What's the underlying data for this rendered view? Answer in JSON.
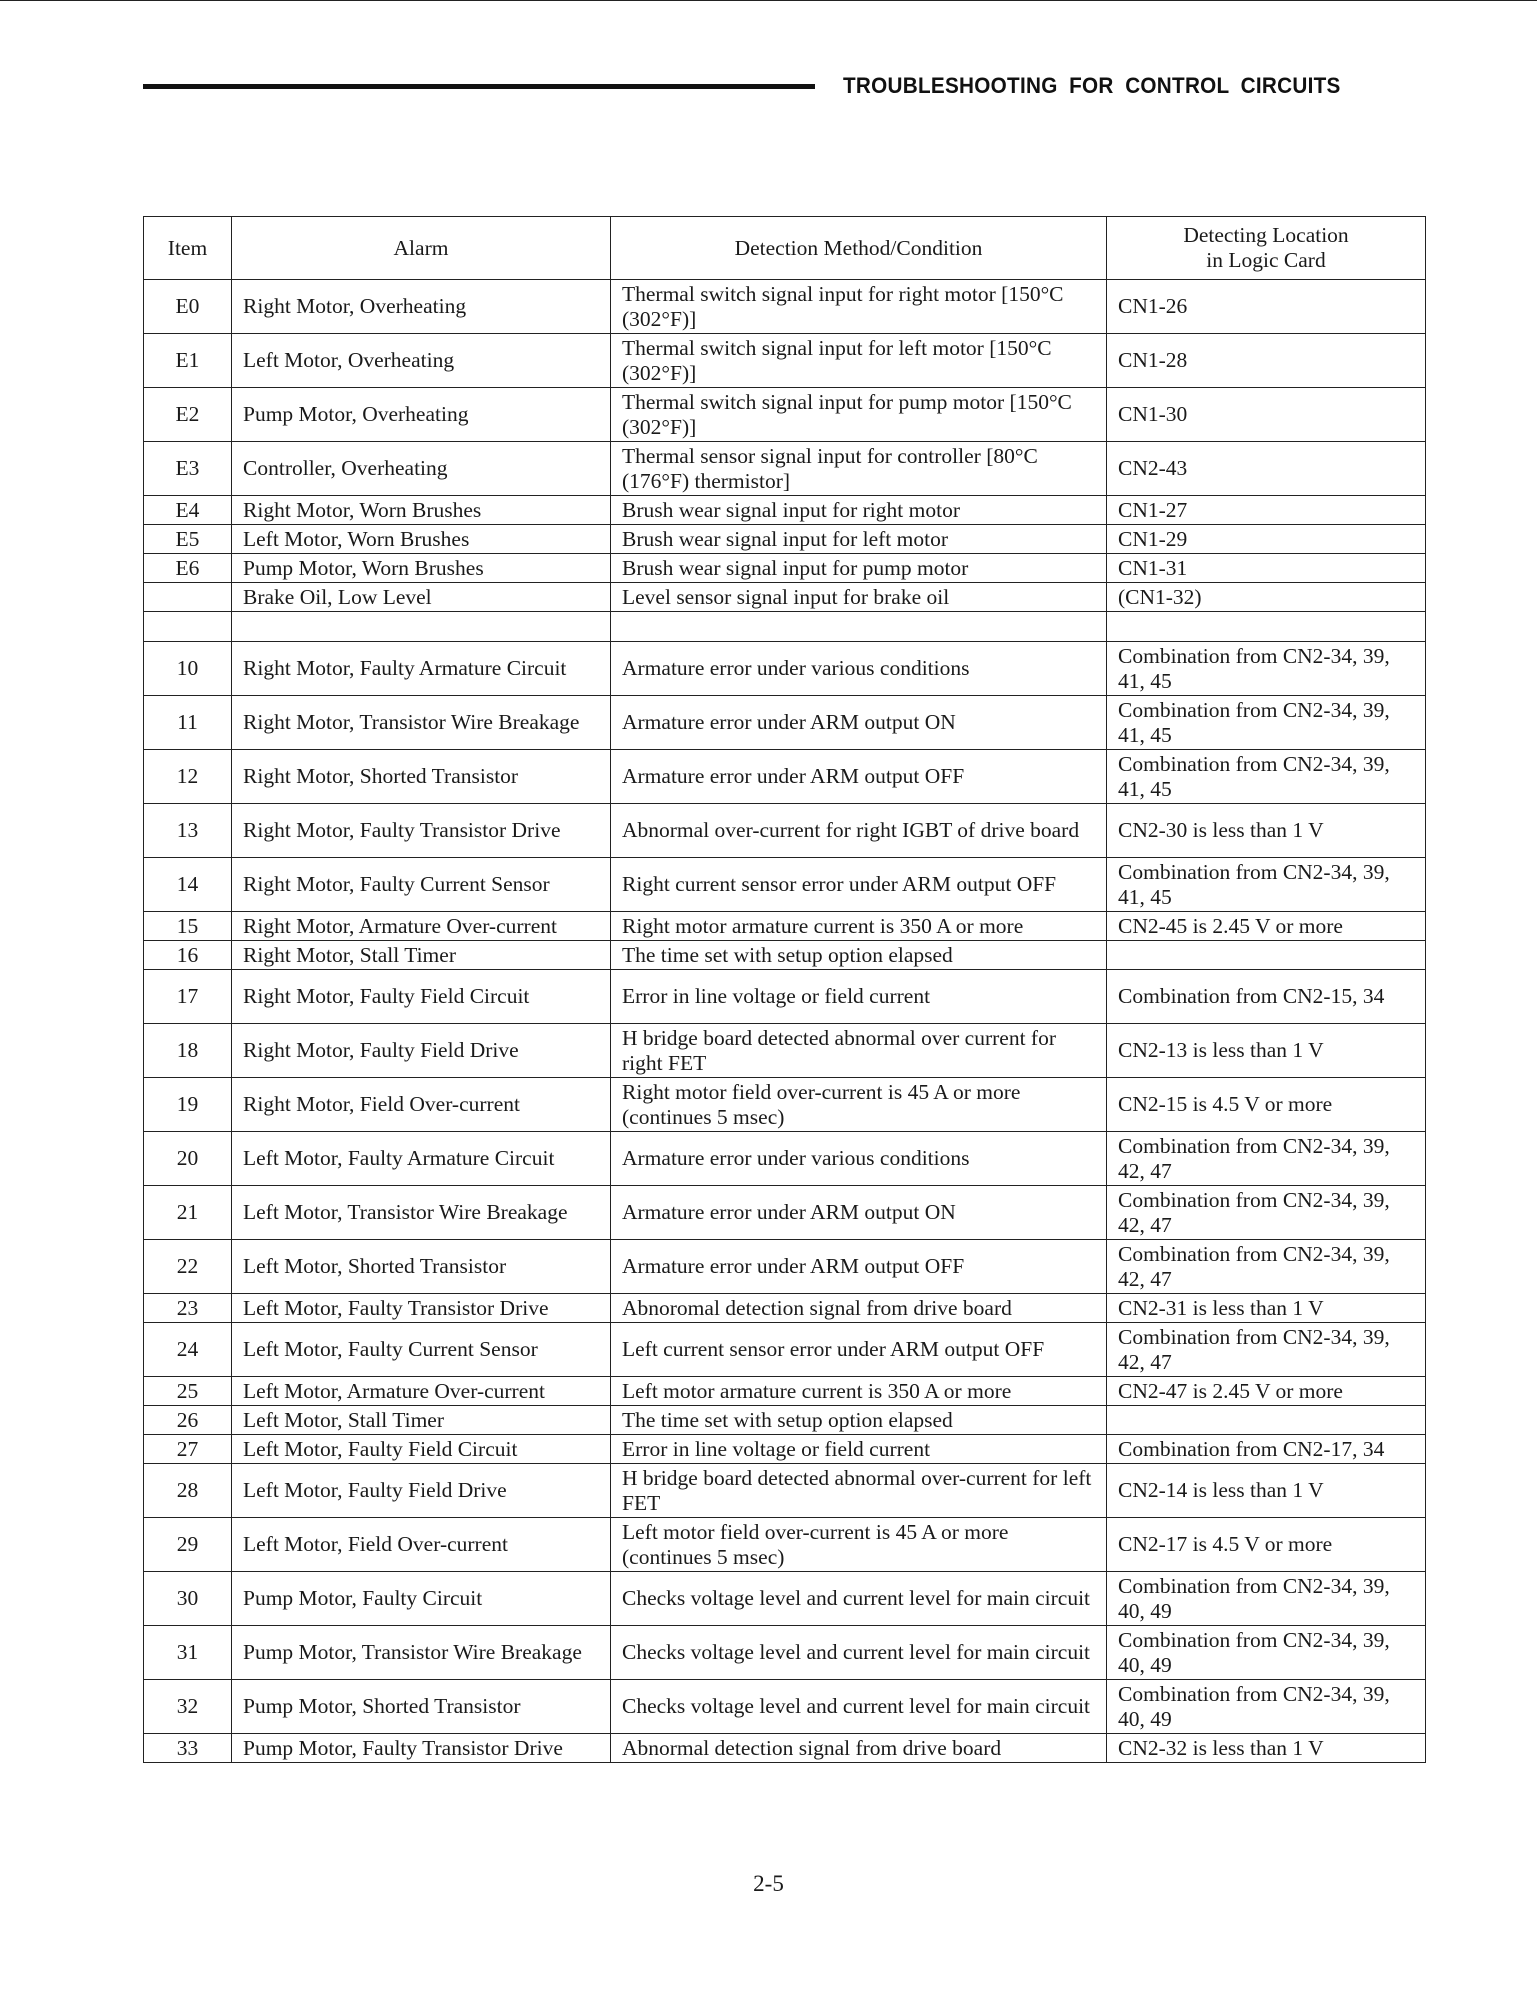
{
  "header": {
    "title": "TROUBLESHOOTING FOR CONTROL CIRCUITS"
  },
  "table": {
    "columns": [
      "Item",
      "Alarm",
      "Detection Method/Condition",
      "Detecting Location in Logic Card"
    ],
    "location_header_lines": [
      "Detecting Location",
      "in Logic Card"
    ],
    "rows": [
      {
        "item": "E0",
        "alarm": "Right Motor, Overheating",
        "detection": "Thermal switch signal input for right motor [150°C (302°F)]",
        "location": "CN1-26",
        "h": "h2"
      },
      {
        "item": "E1",
        "alarm": "Left Motor, Overheating",
        "detection": "Thermal switch signal input for left motor [150°C (302°F)]",
        "location": "CN1-28",
        "h": "h2"
      },
      {
        "item": "E2",
        "alarm": "Pump Motor, Overheating",
        "detection": "Thermal switch signal input for pump motor [150°C (302°F)]",
        "location": "CN1-30",
        "h": "h2"
      },
      {
        "item": "E3",
        "alarm": "Controller, Overheating",
        "detection": "Thermal sensor signal input for controller [80°C (176°F) thermistor]",
        "location": "CN2-43",
        "h": "h2"
      },
      {
        "item": "E4",
        "alarm": "Right Motor, Worn Brushes",
        "detection": "Brush wear signal input for right motor",
        "location": "CN1-27",
        "h": "h1"
      },
      {
        "item": "E5",
        "alarm": "Left Motor, Worn Brushes",
        "detection": "Brush wear signal input for left motor",
        "location": "CN1-29",
        "h": "h1"
      },
      {
        "item": "E6",
        "alarm": "Pump Motor, Worn Brushes",
        "detection": "Brush wear signal input for pump motor",
        "location": "CN1-31",
        "h": "h1"
      },
      {
        "item": "",
        "alarm": "Brake Oil, Low Level",
        "detection": "Level sensor signal input for brake oil",
        "location": "(CN1-32)",
        "h": "h1"
      },
      {
        "item": "",
        "alarm": "",
        "detection": "",
        "location": "",
        "h": "blank"
      },
      {
        "item": "10",
        "alarm": "Right Motor, Faulty Armature Circuit",
        "detection": "Armature error under various conditions",
        "location": "Combination from CN2-34, 39, 41, 45",
        "h": "h2"
      },
      {
        "item": "11",
        "alarm": "Right Motor, Transistor Wire Breakage",
        "detection": "Armature error under ARM output ON",
        "location": "Combination from CN2-34, 39, 41, 45",
        "h": "h2"
      },
      {
        "item": "12",
        "alarm": "Right Motor, Shorted Transistor",
        "detection": "Armature error under ARM output OFF",
        "location": "Combination from CN2-34, 39, 41, 45",
        "h": "h2"
      },
      {
        "item": "13",
        "alarm": "Right Motor, Faulty Transistor Drive",
        "detection": "Abnormal over-current for right IGBT of drive board",
        "location": "CN2-30 is less than 1 V",
        "h": "h2"
      },
      {
        "item": "14",
        "alarm": "Right Motor, Faulty Current Sensor",
        "detection": "Right current sensor error under ARM output OFF",
        "location": "Combination from CN2-34, 39, 41, 45",
        "h": "h2"
      },
      {
        "item": "15",
        "alarm": "Right Motor, Armature Over-current",
        "detection": "Right motor armature current is 350 A or more",
        "location": "CN2-45 is 2.45 V or more",
        "h": "h1"
      },
      {
        "item": "16",
        "alarm": "Right Motor, Stall Timer",
        "detection": "The time set with setup option elapsed",
        "location": "",
        "h": "h1"
      },
      {
        "item": "17",
        "alarm": "Right Motor, Faulty Field Circuit",
        "detection": "Error in line voltage or field current",
        "location": "Combination from CN2-15, 34",
        "h": "h2"
      },
      {
        "item": "18",
        "alarm": "Right Motor, Faulty Field Drive",
        "detection": "H bridge board detected abnormal over current for right FET",
        "location": "CN2-13 is less than 1 V",
        "h": "h2"
      },
      {
        "item": "19",
        "alarm": "Right Motor, Field Over-current",
        "detection": "Right motor field over-current is 45 A or more (continues 5 msec)",
        "location": "CN2-15 is 4.5 V or more",
        "h": "h2"
      },
      {
        "item": "20",
        "alarm": "Left Motor, Faulty Armature Circuit",
        "detection": "Armature error under various conditions",
        "location": "Combination from CN2-34, 39, 42, 47",
        "h": "h2"
      },
      {
        "item": "21",
        "alarm": "Left Motor, Transistor Wire Breakage",
        "detection": "Armature error under ARM output ON",
        "location": "Combination from CN2-34, 39, 42, 47",
        "h": "h2"
      },
      {
        "item": "22",
        "alarm": "Left Motor, Shorted Transistor",
        "detection": "Armature error under ARM output OFF",
        "location": "Combination from CN2-34, 39, 42, 47",
        "h": "h2"
      },
      {
        "item": "23",
        "alarm": "Left Motor, Faulty Transistor Drive",
        "detection": "Abnoromal detection signal from drive board",
        "location": "CN2-31 is less than 1 V",
        "h": "h1"
      },
      {
        "item": "24",
        "alarm": "Left Motor, Faulty Current Sensor",
        "detection": "Left current sensor error under ARM output OFF",
        "location": "Combination from CN2-34, 39, 42, 47",
        "h": "h2"
      },
      {
        "item": "25",
        "alarm": "Left Motor, Armature Over-current",
        "detection": "Left motor armature current is 350 A or more",
        "location": "CN2-47 is 2.45 V or more",
        "h": "h1"
      },
      {
        "item": "26",
        "alarm": "Left Motor, Stall Timer",
        "detection": "The time set with setup option elapsed",
        "location": "",
        "h": "h1"
      },
      {
        "item": "27",
        "alarm": "Left Motor, Faulty Field Circuit",
        "detection": "Error in line voltage or field current",
        "location": "Combination from CN2-17, 34",
        "h": "h1"
      },
      {
        "item": "28",
        "alarm": "Left Motor, Faulty Field Drive",
        "detection": "H bridge board detected abnormal over-current for left FET",
        "location": "CN2-14 is less than 1 V",
        "h": "h2"
      },
      {
        "item": "29",
        "alarm": "Left Motor, Field Over-current",
        "detection": "Left motor field over-current is 45 A or more (continues 5 msec)",
        "location": "CN2-17 is 4.5 V or more",
        "h": "h2"
      },
      {
        "item": "30",
        "alarm": "Pump Motor, Faulty Circuit",
        "detection": "Checks voltage level and current level for main circuit",
        "location": "Combination from CN2-34, 39, 40, 49",
        "h": "h2"
      },
      {
        "item": "31",
        "alarm": "Pump Motor, Transistor Wire Breakage",
        "detection": "Checks voltage level and current level for main circuit",
        "location": "Combination from CN2-34, 39, 40, 49",
        "h": "h2"
      },
      {
        "item": "32",
        "alarm": "Pump Motor, Shorted Transistor",
        "detection": "Checks voltage level and current level for main circuit",
        "location": "Combination from CN2-34, 39, 40, 49",
        "h": "h2"
      },
      {
        "item": "33",
        "alarm": "Pump Motor, Faulty Transistor Drive",
        "detection": "Abnormal detection signal from drive board",
        "location": "CN2-32 is less than 1 V",
        "h": "h1"
      }
    ]
  },
  "footer": {
    "page_number": "2-5"
  }
}
